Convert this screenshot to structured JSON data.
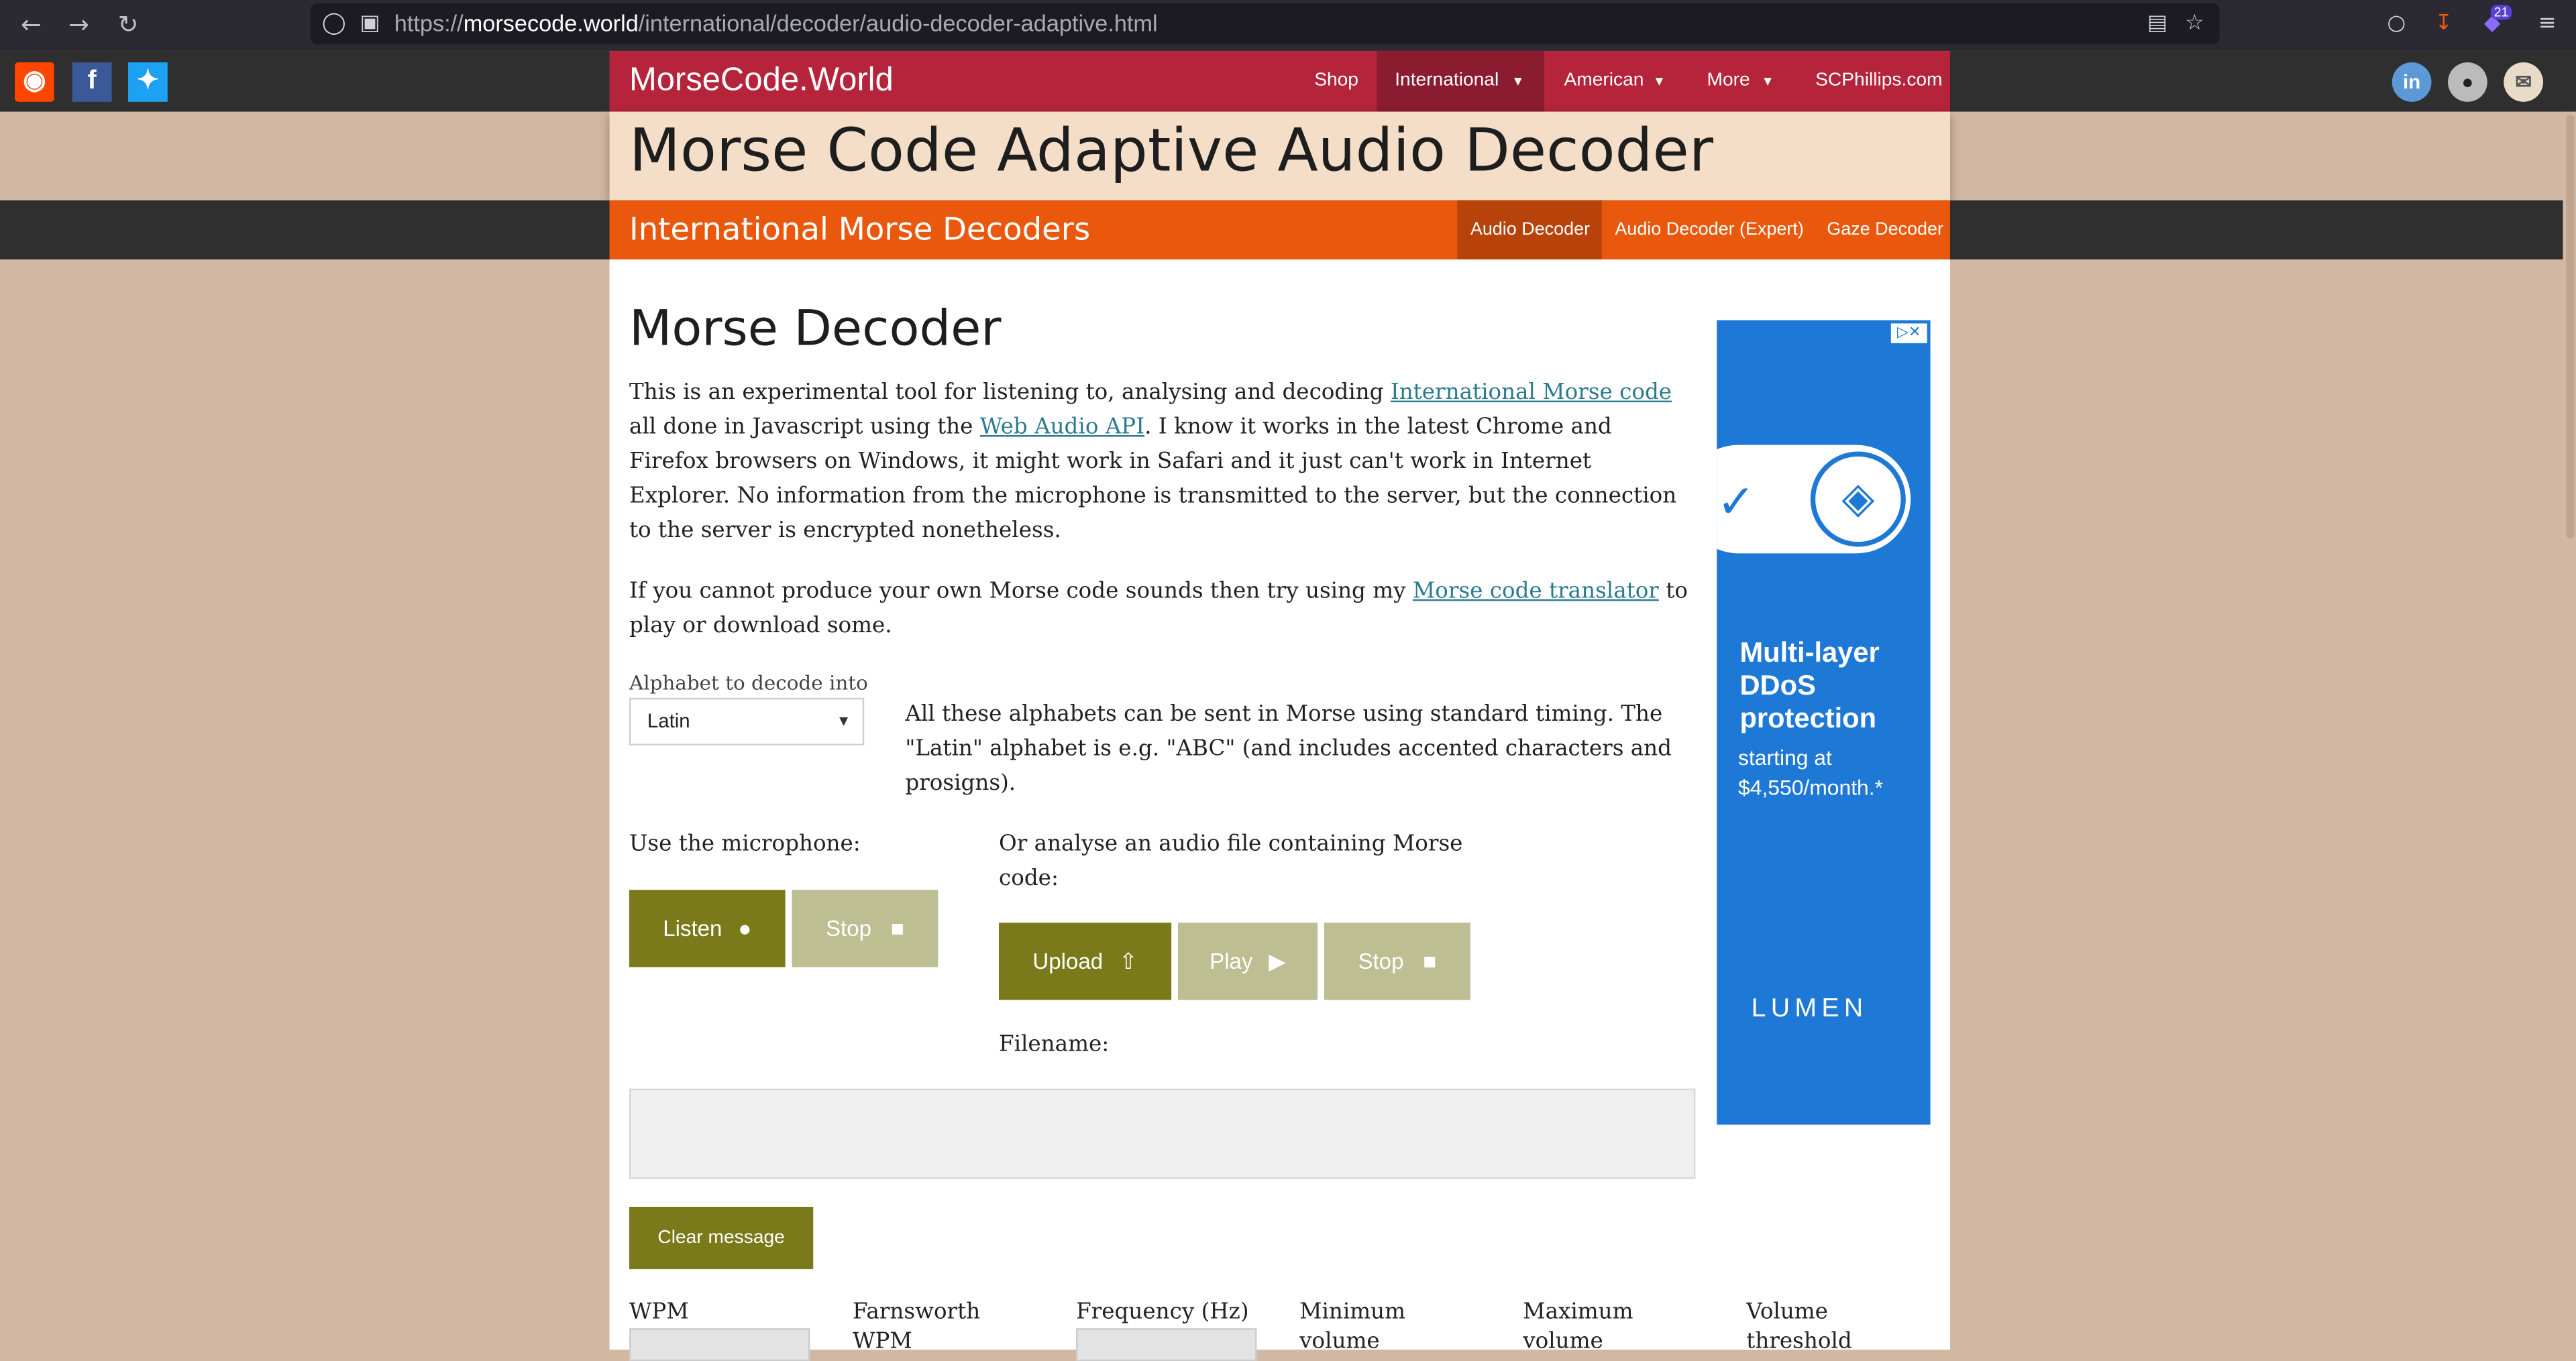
{
  "browser": {
    "url_prefix": "https://",
    "url_host": "morsecode.world",
    "url_path": "/international/decoder/audio-decoder-adaptive.html",
    "notification_count": "21"
  },
  "site": {
    "brand": "MorseCode.World",
    "nav": [
      {
        "label": "Shop"
      },
      {
        "label": "International"
      },
      {
        "label": "American"
      },
      {
        "label": "More"
      },
      {
        "label": "SCPhillips.com"
      }
    ],
    "page_title": "Morse Code Adaptive Audio Decoder",
    "section_title": "International Morse Decoders",
    "subnav": [
      {
        "label": "Audio Decoder"
      },
      {
        "label": "Audio Decoder (Expert)"
      },
      {
        "label": "Gaze Decoder"
      }
    ]
  },
  "main": {
    "heading": "Morse Decoder",
    "p1_a": "This is an experimental tool for listening to, analysing and decoding ",
    "p1_link1": "International Morse code",
    "p1_b": " all done in Javascript using the ",
    "p1_link2": "Web Audio API",
    "p1_c": ". I know it works in the latest Chrome and Firefox browsers on Windows, it might work in Safari and it just can't work in Internet Explorer. No information from the microphone is transmitted to the server, but the connection to the server is encrypted nonetheless.",
    "p2_a": "If you cannot produce your own Morse code sounds then try using my ",
    "p2_link": "Morse code translator",
    "p2_b": " to play or download some.",
    "alphabet_label": "Alphabet to decode into",
    "alphabet_value": "Latin",
    "alphabet_note": "All these alphabets can be sent in Morse using standard timing. The \"Latin\" alphabet is e.g. \"ABC\" (and includes accented characters and prosigns).",
    "mic_label": "Use the microphone:",
    "listen_label": "Listen",
    "mic_stop_label": "Stop",
    "file_label": "Or analyse an audio file containing Morse code:",
    "upload_label": "Upload",
    "play_label": "Play",
    "file_stop_label": "Stop",
    "filename_label": "Filename:",
    "clear_label": "Clear message",
    "params": [
      {
        "label": "WPM"
      },
      {
        "label": "Farnsworth WPM"
      },
      {
        "label": "Frequency (Hz)"
      },
      {
        "label": "Minimum volume"
      },
      {
        "label": "Maximum volume"
      },
      {
        "label": "Volume threshold"
      }
    ]
  },
  "ad": {
    "headline": "Multi-layer DDoS protection",
    "subtext": "starting at $4,550/month.*",
    "logo": "LUMEN"
  },
  "colors": {
    "brand_red": "#b5243a",
    "orange": "#e9580c",
    "olive": "#7a7a1a",
    "olive_light": "#bdbe92",
    "ad_blue": "#1e78d6",
    "page_bg": "#d2b7a2"
  }
}
